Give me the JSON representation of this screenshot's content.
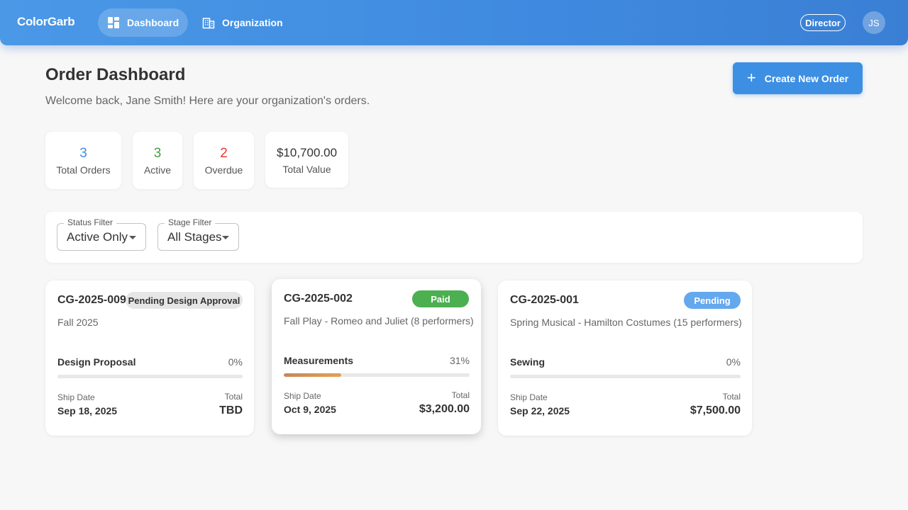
{
  "nav": {
    "brand": "ColorGarb",
    "items": [
      {
        "label": "Dashboard",
        "icon": "dashboard-icon",
        "active": true
      },
      {
        "label": "Organization",
        "icon": "building-icon",
        "active": false
      }
    ],
    "role": "Director",
    "avatar_initials": "JS"
  },
  "header": {
    "title": "Order Dashboard",
    "subtitle": "Welcome back, Jane Smith! Here are your organization's orders.",
    "create_button": "Create New Order"
  },
  "stats": [
    {
      "value": "3",
      "label": "Total Orders",
      "color": "#3d8fe3"
    },
    {
      "value": "3",
      "label": "Active",
      "color": "#43a047"
    },
    {
      "value": "2",
      "label": "Overdue",
      "color": "#e53935"
    },
    {
      "value": "$10,700.00",
      "label": "Total Value",
      "color": "#333333"
    }
  ],
  "filters": {
    "status": {
      "legend": "Status Filter",
      "value": "Active Only"
    },
    "stage": {
      "legend": "Stage Filter",
      "value": "All Stages"
    }
  },
  "orders": [
    {
      "id": "CG-2025-009",
      "badge": "Pending Design Approval",
      "badge_color": "#e6e6e6",
      "badge_text_color": "#333333",
      "description": "Fall 2025",
      "stage": "Design Proposal",
      "progress_label": "0%",
      "progress": 0,
      "ship_label": "Ship Date",
      "ship_date": "Sep 18, 2025",
      "total_label": "Total",
      "total": "TBD"
    },
    {
      "id": "CG-2025-002",
      "badge": "Paid",
      "badge_color": "#4caf50",
      "badge_text_color": "#ffffff",
      "description": "Fall Play - Romeo and Juliet (8 performers)",
      "stage": "Measurements",
      "progress_label": "31%",
      "progress": 31,
      "ship_label": "Ship Date",
      "ship_date": "Oct 9, 2025",
      "total_label": "Total",
      "total": "$3,200.00"
    },
    {
      "id": "CG-2025-001",
      "badge": "Pending",
      "badge_color": "#64a8ee",
      "badge_text_color": "#ffffff",
      "description": "Spring Musical - Hamilton Costumes (15 performers)",
      "stage": "Sewing",
      "progress_label": "0%",
      "progress": 0,
      "ship_label": "Ship Date",
      "ship_date": "Sep 22, 2025",
      "total_label": "Total",
      "total": "$7,500.00"
    }
  ]
}
